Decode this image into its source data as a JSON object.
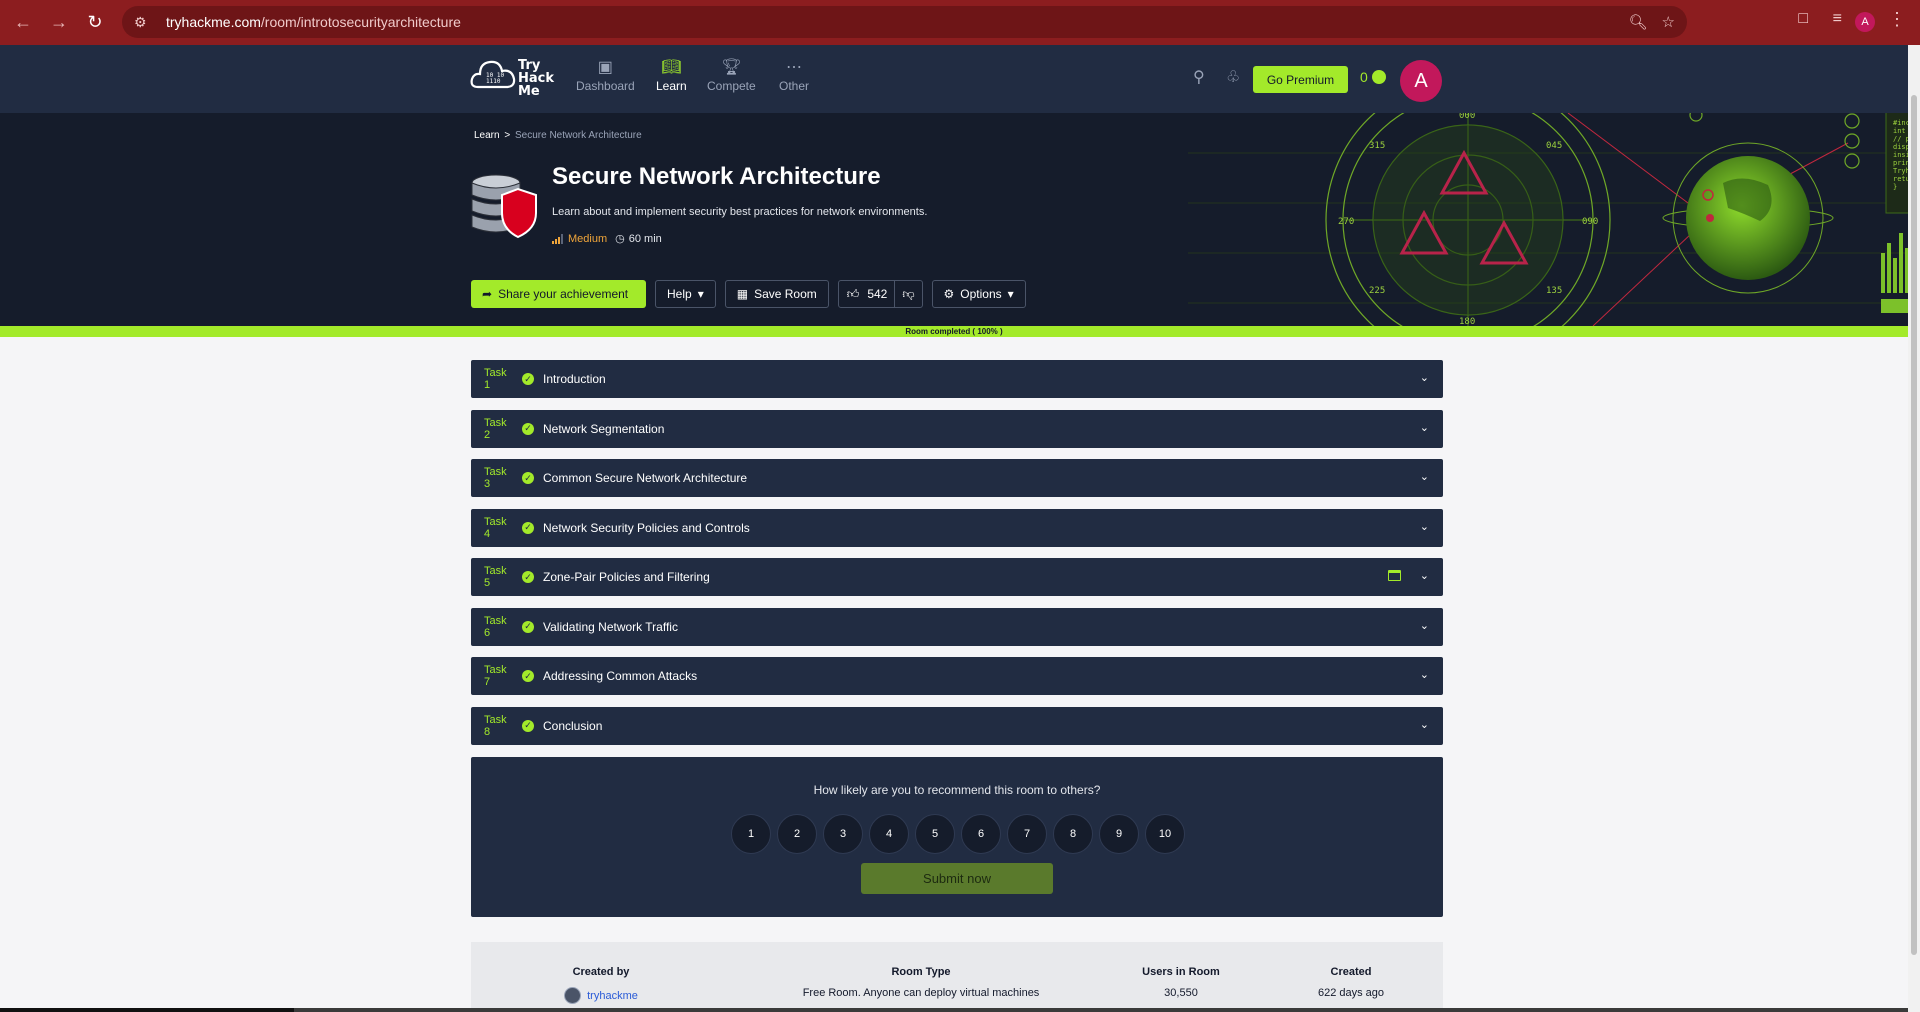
{
  "browser": {
    "url_host": "tryhackme.com",
    "url_path": "/room/introtosecurityarchitecture",
    "profile_initial": "A"
  },
  "header": {
    "logo_text": [
      "Try",
      "Hack",
      "Me"
    ],
    "nav": [
      {
        "label": "Dashboard",
        "icon": "dashboard-icon"
      },
      {
        "label": "Learn",
        "icon": "book-icon",
        "active": true
      },
      {
        "label": "Compete",
        "icon": "trophy-icon"
      },
      {
        "label": "Other",
        "icon": "dots-icon"
      }
    ],
    "premium_label": "Go Premium",
    "streak_count": "0",
    "avatar_initial": "A"
  },
  "hero": {
    "breadcrumb": {
      "root": "Learn",
      "separator": ">",
      "current": "Secure Network Architecture"
    },
    "title": "Secure Network Architecture",
    "description": "Learn about and implement security best practices for network environments.",
    "difficulty": "Medium",
    "duration": "60 min",
    "actions": {
      "share": "Share your achievement",
      "help": "Help",
      "save": "Save Room",
      "likes": "542",
      "options": "Options"
    },
    "art_labels": [
      "000",
      "045",
      "090",
      "135",
      "180",
      "225",
      "270",
      "315"
    ],
    "art_code": [
      "#include <stdio.h>",
      "int main() {",
      "  // printf()",
      "displays the string",
      "inside quotation",
      "  print(\"Welcome to",
      "Tryhackme!\");",
      "  return 0;",
      "}"
    ]
  },
  "progress": {
    "label": "Room completed ( 100% )",
    "percent": 100
  },
  "tasks": [
    {
      "number": "Task 1",
      "title": "Introduction",
      "done": true
    },
    {
      "number": "Task 2",
      "title": "Network Segmentation",
      "done": true
    },
    {
      "number": "Task 3",
      "title": "Common Secure Network Architecture",
      "done": true
    },
    {
      "number": "Task 4",
      "title": "Network Security Policies and Controls",
      "done": true
    },
    {
      "number": "Task 5",
      "title": "Zone-Pair Policies and Filtering",
      "done": true,
      "has_machine": true
    },
    {
      "number": "Task 6",
      "title": "Validating Network Traffic",
      "done": true
    },
    {
      "number": "Task 7",
      "title": "Addressing Common Attacks",
      "done": true
    },
    {
      "number": "Task 8",
      "title": "Conclusion",
      "done": true
    }
  ],
  "recommend": {
    "question": "How likely are you to recommend this room to others?",
    "options": [
      "1",
      "2",
      "3",
      "4",
      "5",
      "6",
      "7",
      "8",
      "9",
      "10"
    ],
    "submit": "Submit now"
  },
  "info": {
    "created_by_label": "Created by",
    "created_by": "tryhackme",
    "room_type_label": "Room Type",
    "room_type": "Free Room. Anyone can deploy virtual machines",
    "users_label": "Users in Room",
    "users": "30,550",
    "created_label": "Created",
    "created": "622 days ago"
  },
  "colors": {
    "accent": "#a3ea2a",
    "navy": "#212c42",
    "hero_bg": "#151c2b",
    "browser_red": "#8c1d1f",
    "avatar": "#c2185b",
    "difficulty": "#f0a53a"
  }
}
